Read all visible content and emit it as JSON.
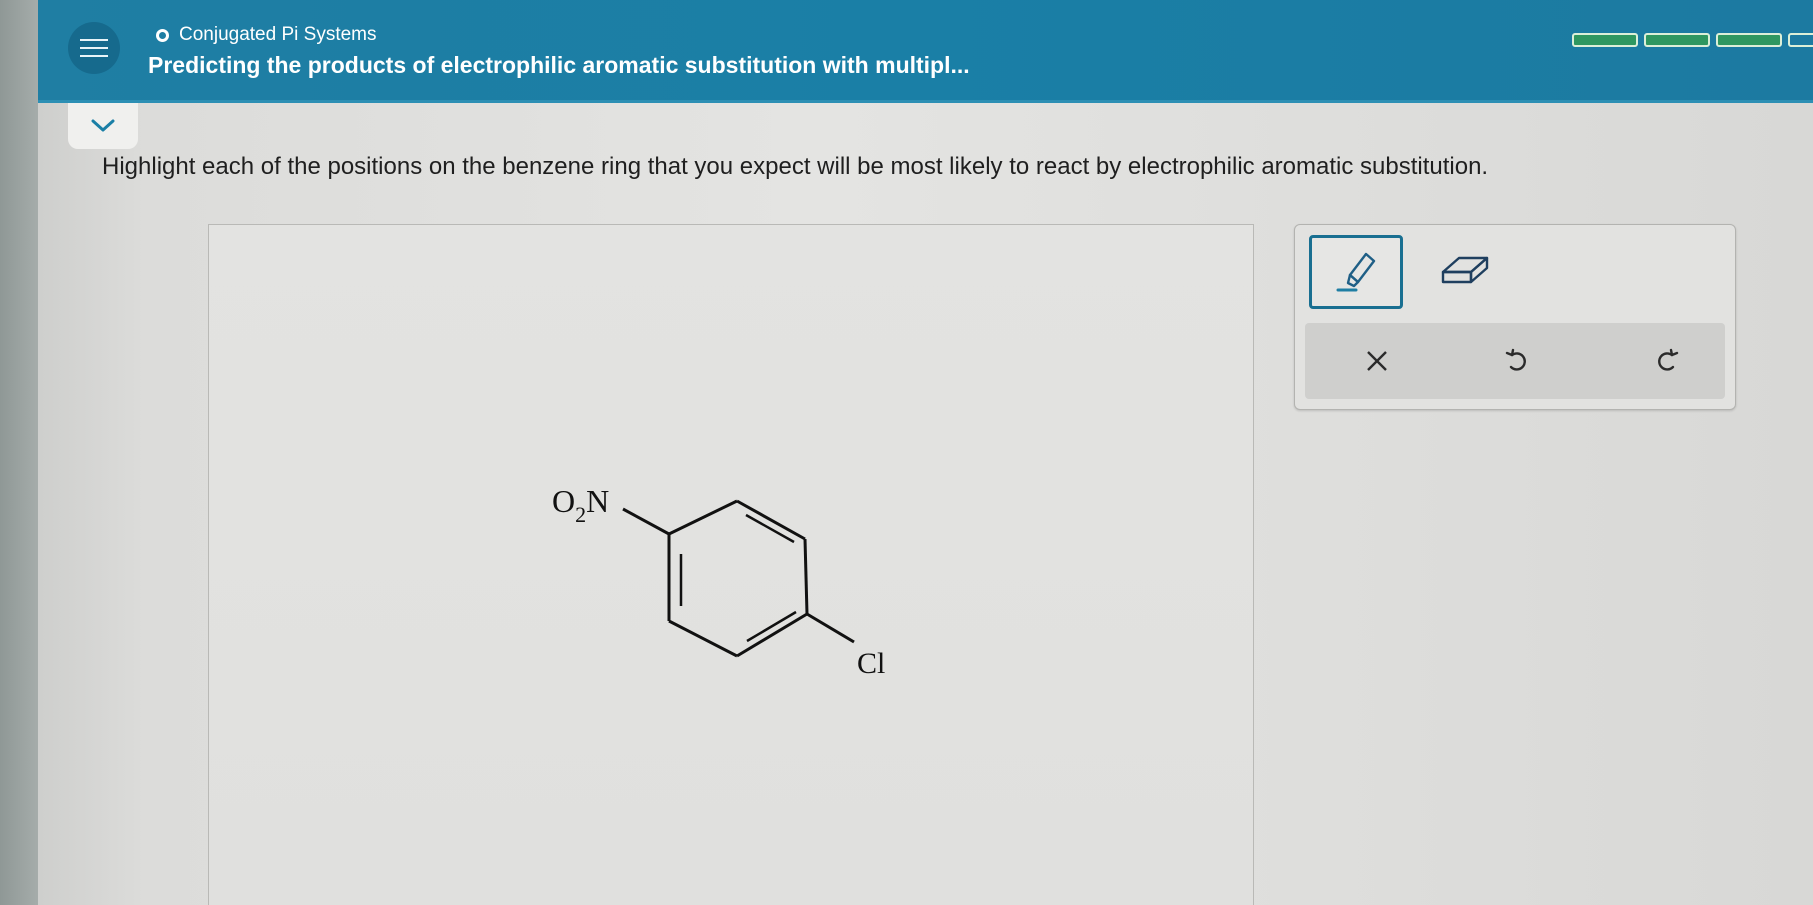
{
  "header": {
    "topic": "Conjugated Pi Systems",
    "title": "Predicting the products of electrophilic aromatic substitution with multipl...",
    "progress_segments": [
      "filled",
      "filled",
      "filled",
      "empty"
    ],
    "colors": {
      "header": "#1a7fa6",
      "progress": "#2f9760"
    }
  },
  "icons": {
    "menu": "hamburger-menu-icon",
    "collapse": "chevron-down-icon",
    "highlight": "highlighter-pen-icon",
    "eraser": "eraser-icon",
    "clear": "close-x-icon",
    "undo": "undo-icon",
    "redo": "redo-icon"
  },
  "question": {
    "instruction": "Highlight each of the positions on the benzene ring that you expect will be most likely to react by electrophilic aromatic substitution."
  },
  "molecule": {
    "substituent_top_o": "O",
    "substituent_top_sub": "2",
    "substituent_top_n": "N",
    "substituent_bottom": "Cl"
  }
}
